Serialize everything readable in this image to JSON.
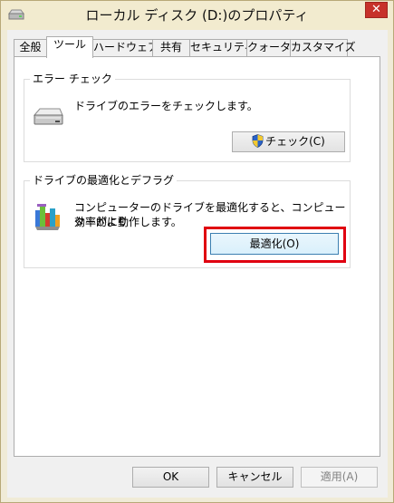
{
  "window": {
    "title": "ローカル ディスク (D:)のプロパティ",
    "close_label": "✕"
  },
  "tabs": [
    {
      "label": "全般"
    },
    {
      "label": "ツール"
    },
    {
      "label": "ハードウェア"
    },
    {
      "label": "共有"
    },
    {
      "label": "セキュリティ"
    },
    {
      "label": "クォータ"
    },
    {
      "label": "カスタマイズ"
    }
  ],
  "active_tab": "ツール",
  "error_check": {
    "title": "エラー チェック",
    "description": "ドライブのエラーをチェックします。",
    "button_label": "チェック(C)"
  },
  "optimize": {
    "title": "ドライブの最適化とデフラグ",
    "description_line1": "コンピューターのドライブを最適化すると、コンピューターがより",
    "description_line2": "効率的に動作します。",
    "button_label": "最適化(O)",
    "highlight_color": "#e00010"
  },
  "footer": {
    "ok_label": "OK",
    "cancel_label": "キャンセル",
    "apply_label": "適用(A)"
  },
  "colors": {
    "close_button": "#c7312a",
    "window_frame": "#f0ebd7",
    "focused_border": "#3c7fb1"
  }
}
